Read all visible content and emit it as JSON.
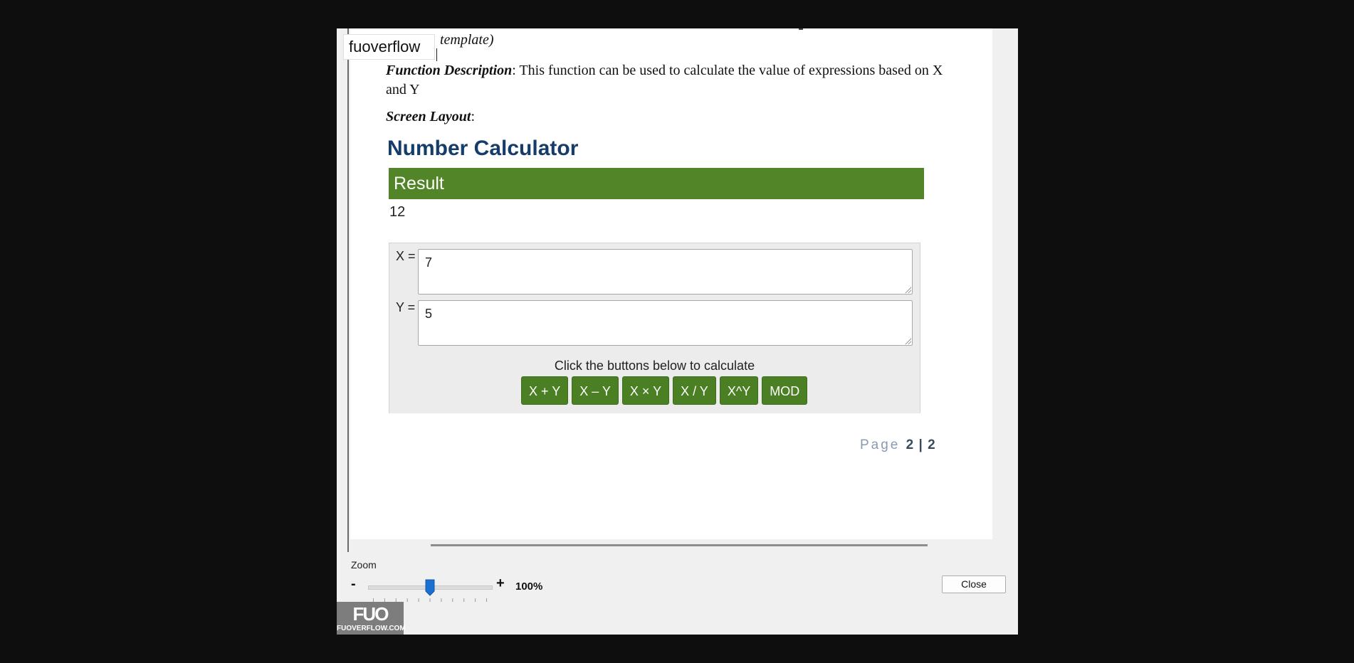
{
  "document": {
    "template_fragment": "template)",
    "description_label": "Function Description",
    "description_text": ": This function can be used to calculate the value of expressions based on X and Y",
    "layout_label": "Screen Layout",
    "layout_colon": ":",
    "page_prefix": "Page",
    "page_number": "2 | 2"
  },
  "calculator": {
    "title": "Number Calculator",
    "result_heading": "Result",
    "result_value": "12",
    "x_label": "X =",
    "x_value": "7",
    "y_label": "Y =",
    "y_value": "5",
    "hint": "Click the buttons below to calculate",
    "buttons": [
      "X + Y",
      "X – Y",
      "X × Y",
      "X / Y",
      "X^Y",
      "MOD"
    ],
    "colors": {
      "result_bar": "#528527",
      "button": "#4a7f24",
      "title": "#163c6a"
    }
  },
  "tooltip": {
    "text": "fuoverflow"
  },
  "zoom": {
    "label": "Zoom",
    "minus": "-",
    "plus": "+",
    "value_text": "100%",
    "level_fraction": 0.5
  },
  "close_label": "Close",
  "watermark": {
    "mark": "FUO",
    "text": "FUOVERFLOW.COM"
  }
}
